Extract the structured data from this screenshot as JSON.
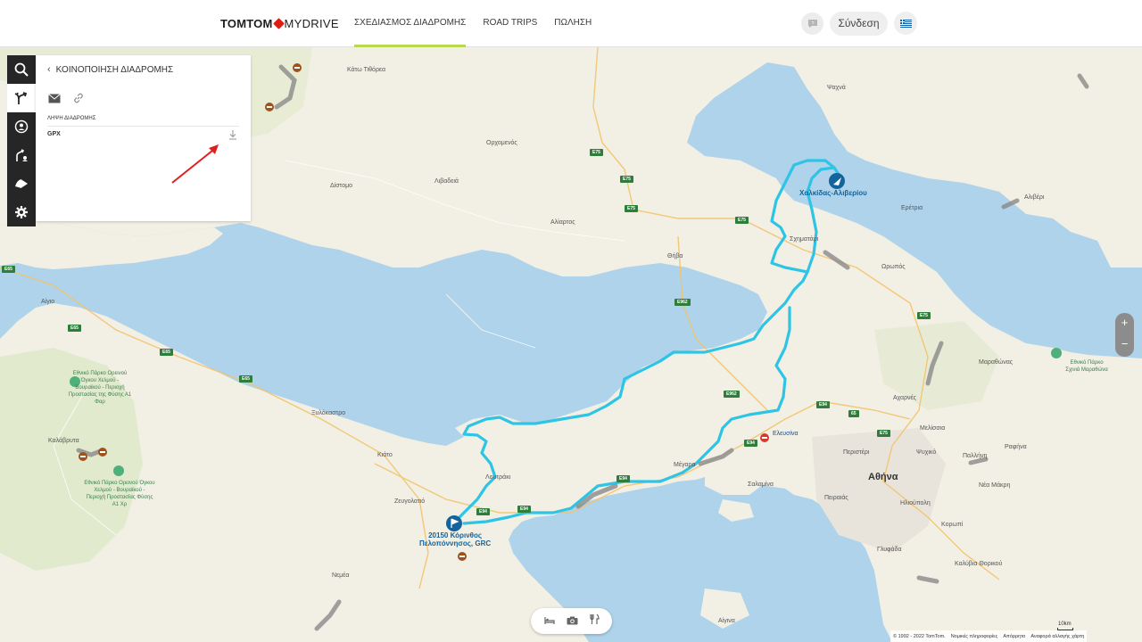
{
  "header": {
    "logo_brand": "TOMTOM",
    "logo_product": "MYDRIVE",
    "nav": [
      {
        "label": "ΣΧΕΔΙΑΣΜΟΣ ΔΙΑΔΡΟΜΗΣ",
        "active": true
      },
      {
        "label": "ROAD TRIPS",
        "active": false
      },
      {
        "label": "ΠΩΛΗΣΗ",
        "active": false
      }
    ],
    "login_label": "Σύνδεση",
    "feedback_icon": "feedback-icon",
    "language": "Greek flag",
    "accent_color": "#b8d94b"
  },
  "toolbar": {
    "items": [
      "search-icon",
      "route-icon",
      "places-icon",
      "my-routes-icon",
      "traffic-icon",
      "settings-icon"
    ],
    "active_item": "route-icon"
  },
  "panel": {
    "title": "ΚΟΙΝΟΠΟΙΗΣΗ ΔΙΑΔΡΟΜΗΣ",
    "share_options": [
      "mail-icon",
      "link-icon"
    ],
    "download_heading": "ΛΗΨΗ ΔΙΑΔΡΟΜΗΣ",
    "download_format": "GPX",
    "download_icon": "download-icon"
  },
  "map": {
    "route_color": "#2ec4e6",
    "start": {
      "line1": "20150 Κόρινθος",
      "line2": "Πελοπόννησος, GRC"
    },
    "destination": "Χαλκίδας-Αλιβερίου",
    "cities": {
      "athens": "Αθήνα",
      "peristeri": "Περιστέρι",
      "piraeus": "Πειραιάς",
      "megara": "Μέγαρα",
      "elefsina": "Ελευσίνα",
      "thiva": "Θήβα",
      "aliartos": "Αλίαρτος",
      "livadeia": "Λιβαδειά",
      "orchomenos": "Ορχομενός",
      "kato_tithorea": "Κάτω Τιθόρεα",
      "distomo": "Δίστομο",
      "schimatari": "Σχηματάρι",
      "oropos": "Ωρωπός",
      "eretria": "Ερέτρια",
      "aliveri": "Αλιβέρι",
      "psachna": "Ψαχνά",
      "loutraki": "Λουτράκι",
      "zevgolatio": "Ζευγολατιό",
      "kiato": "Κιάτο",
      "xylokastro": "Ξυλόκαστρο",
      "aigio": "Αίγιο",
      "kalavryta": "Καλάβρυτα",
      "nemea": "Νεμέα",
      "salamina": "Σαλαμίνα",
      "acharnes": "Αχαρνές",
      "melissia": "Μελίσσια",
      "psychiko": "Ψυχικό",
      "pallini": "Παλλήνη",
      "rafina": "Ραφήνα",
      "marathonas": "Μαραθώνας",
      "ilioupoli": "Ηλιούπολη",
      "glyfada": "Γλυφάδα",
      "koropi": "Κορωπί",
      "kalyvia": "Καλύβια Θορικού",
      "nea_makri": "Νέα Μάκρη",
      "aigina": "Αίγινα"
    },
    "parks": {
      "chelmos": "Εθνικό Πάρκο Ορεινού Όγκου Χελμού - Βουραϊκού - Περιοχή Προστασίας της Φύσης Α1 Φαρ",
      "chelmos2": "Εθνικό Πάρκο Ορεινού Όγκου Χελμού - Βουραϊκού - Περιοχή Προστασίας Φύσης Α1 Χρ",
      "schinias": "Εθνικό Πάρκο Σχινιά Μαραθώνα"
    },
    "road_shields": [
      "E75",
      "E75",
      "E75",
      "E75",
      "E75",
      "E962",
      "E962",
      "E94",
      "E94",
      "E94",
      "E94",
      "E94",
      "E65",
      "E65",
      "E65",
      "E65",
      "65",
      "E75"
    ]
  },
  "zoom": {
    "in": "+",
    "out": "−"
  },
  "poi_bar": [
    "hotel-icon",
    "camera-icon",
    "restaurant-icon"
  ],
  "footer": {
    "copyright": "© 1992 - 2022 TomTom.",
    "legal": "Νομικές πληροφορίες",
    "privacy": "Απόρρητο",
    "report": "Αναφορά αλλαγής χάρτη",
    "scale": "10km"
  }
}
